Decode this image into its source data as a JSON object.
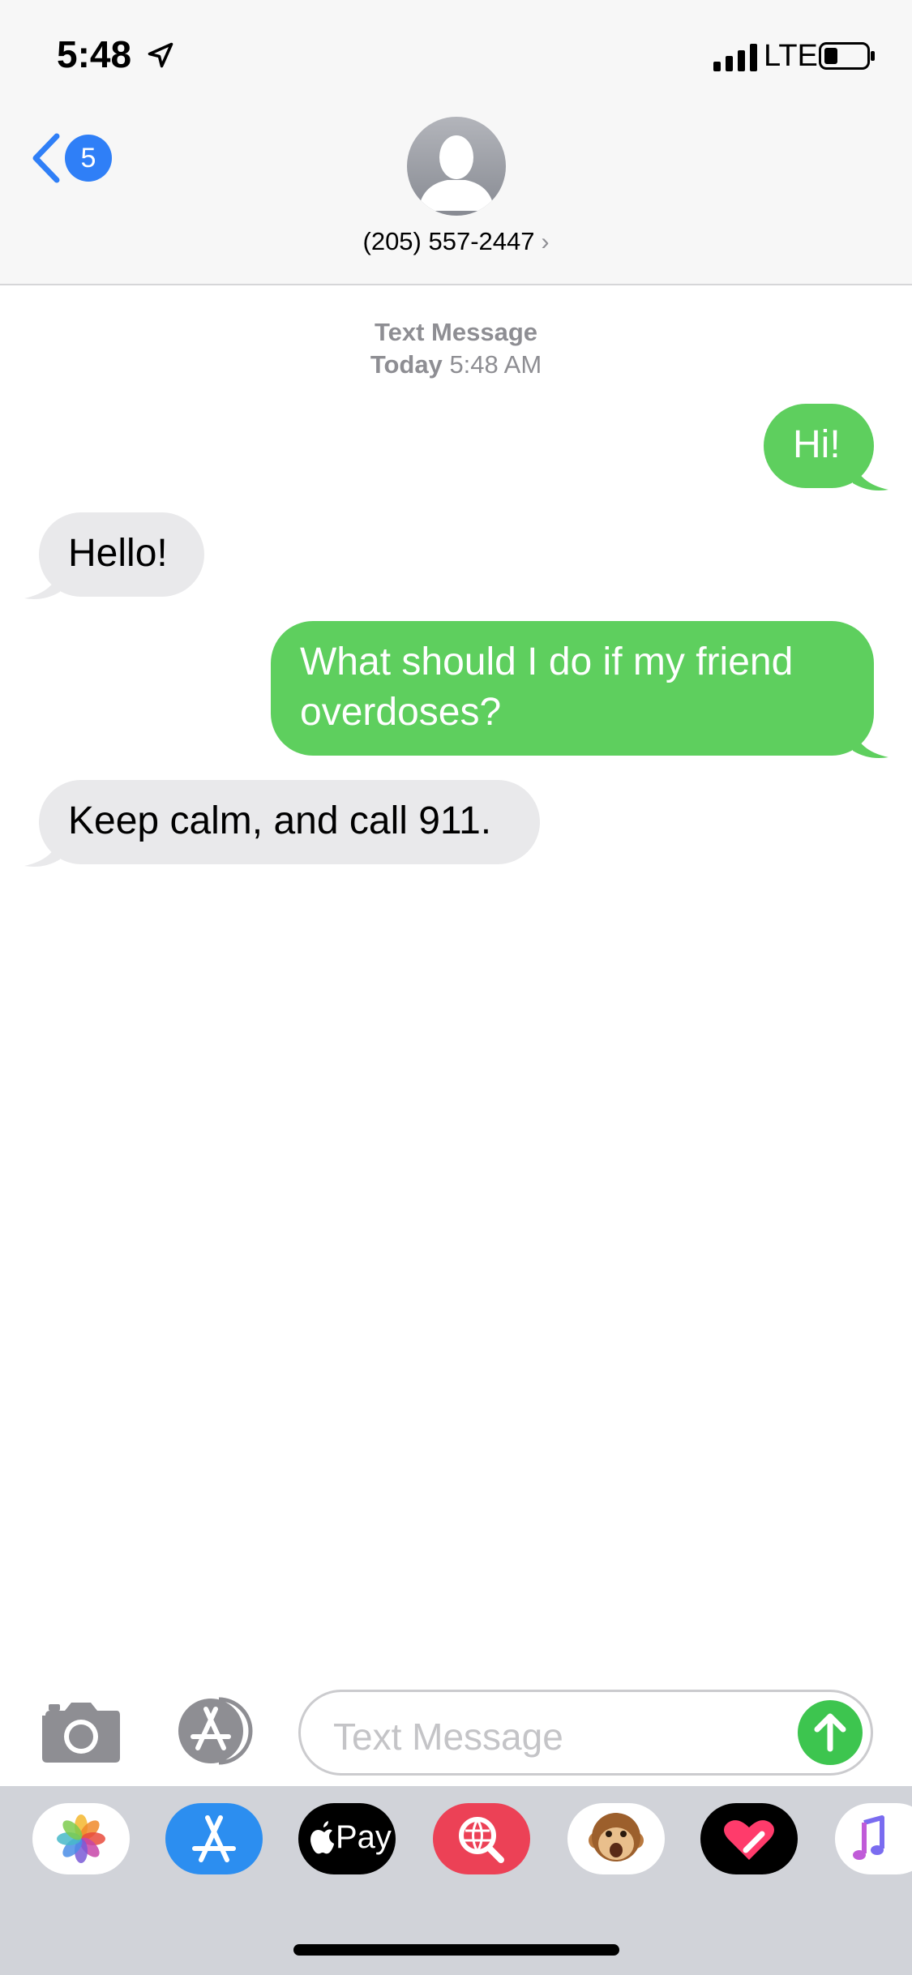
{
  "status_bar": {
    "time": "5:48",
    "network": "LTE"
  },
  "header": {
    "back_count": "5",
    "contact": "(205) 557-2447"
  },
  "conversation": {
    "service_label": "Text Message",
    "day_label": "Today",
    "time_label": "5:48 AM",
    "messages": [
      {
        "direction": "sent",
        "text": "Hi!"
      },
      {
        "direction": "received",
        "text": "Hello!"
      },
      {
        "direction": "sent",
        "text": "What should I do if my friend overdoses?"
      },
      {
        "direction": "received",
        "text": "Keep calm, and call 911."
      }
    ]
  },
  "composer": {
    "placeholder": "Text Message"
  },
  "app_drawer": {
    "apps": [
      "photos-icon",
      "app-store-icon",
      "apple-pay-icon",
      "web-images-icon",
      "animoji-icon",
      "digital-touch-icon",
      "music-icon"
    ],
    "apple_pay_label": "Pay"
  },
  "colors": {
    "sent_bubble": "#5ecf5e",
    "received_bubble": "#e9e9eb",
    "accent": "#2f7ff7",
    "send_button": "#3dc54f"
  }
}
